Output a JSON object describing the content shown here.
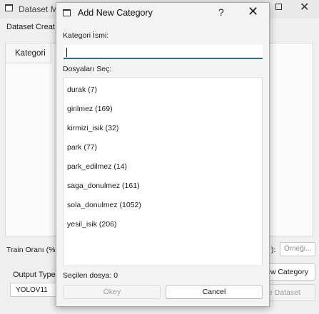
{
  "background_window": {
    "title": "Dataset M",
    "menu_label": "Dataset Creat",
    "tab_label": "Kategori",
    "train_ratio_label": "Train Oranı (%",
    "paren_fragment": "):",
    "example_placeholder": "Örneği...",
    "output_type_label": "Output Type",
    "output_type_value": "YOLOV11",
    "new_category_button": "ew Category",
    "create_dataset_button": "te Dataset"
  },
  "dialog": {
    "title": "Add New Category",
    "help_glyph": "?",
    "close_glyph": "✕",
    "category_name_label": "Kategori İsmi:",
    "category_name_value": "",
    "files_label": "Dosyaları Seç:",
    "files": [
      "durak (7)",
      "girilmez (169)",
      "kirmizi_isik (32)",
      "park (77)",
      "park_edilmez (14)",
      "saga_donulmez (161)",
      "sola_donulmez (1052)",
      "yesil_isik (206)"
    ],
    "selected_files_label": "Seçilen dosya: 0",
    "ok_button": "Okey",
    "cancel_button": "Cancel"
  }
}
